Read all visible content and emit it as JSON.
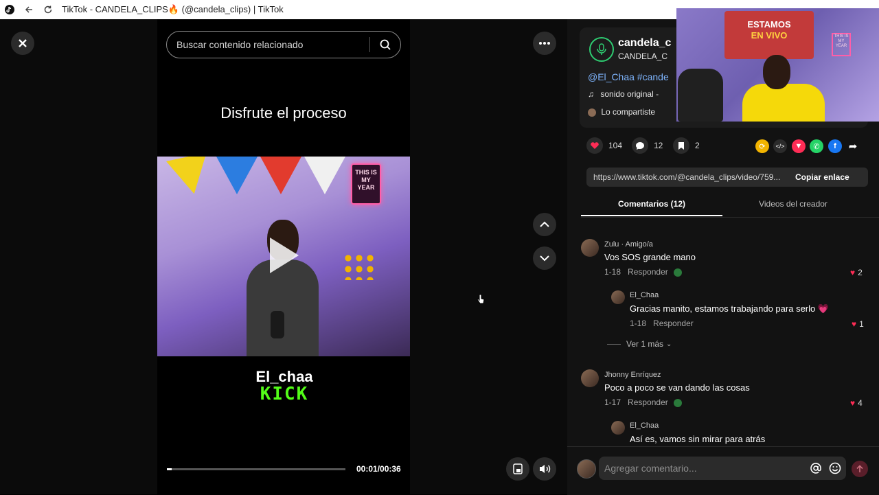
{
  "browser": {
    "title": "TikTok - CANDELA_CLIPS🔥 (@candela_clips) | TikTok"
  },
  "video": {
    "search_placeholder": "Buscar contenido relacionado",
    "caption": "Disfrute el proceso",
    "watermark_top": "El_chaa",
    "watermark_bottom": "KICK",
    "neon_text": "THIS IS MY YEAR",
    "timecode": "00:01/00:36",
    "progress_fraction": 0.028
  },
  "panel": {
    "author": "candela_c",
    "author_nick": "CANDELA_C",
    "description": "@El_Chaa #cande",
    "music": "sonido original -",
    "shared": "Lo compartiste",
    "stream_sign_1": "ESTAMOS",
    "stream_sign_2": "EN VIVO",
    "stream_neon": "THIS IS MY YEAR",
    "likes": "104",
    "comments_count": "12",
    "saves": "2",
    "link": "https://www.tiktok.com/@candela_clips/video/759...",
    "copy_label": "Copiar enlace",
    "tabs": [
      "Comentarios (12)",
      "Videos del creador"
    ]
  },
  "comments": [
    {
      "name": "Zulu · Amigo/a",
      "text": "Vos SOS grande mano",
      "date": "1-18",
      "reply": "Responder",
      "likes": "2"
    },
    {
      "name": "El_Chaa",
      "text": "Gracias manito, estamos trabajando para serlo 💗",
      "date": "1-18",
      "reply": "Responder",
      "likes": "1"
    },
    {
      "more": "Ver 1 más"
    },
    {
      "name": "Jhonny Enríquez",
      "text": "Poco a poco se van dando las cosas",
      "date": "1-17",
      "reply": "Responder",
      "likes": "4"
    },
    {
      "name": "El_Chaa",
      "text": "Así es, vamos sin mirar para atrás"
    }
  ],
  "composer": {
    "placeholder": "Agregar comentario..."
  },
  "colors": {
    "accent": "#fe2c55",
    "kick_green": "#53fc18",
    "link_blue": "#7fb6ff"
  }
}
